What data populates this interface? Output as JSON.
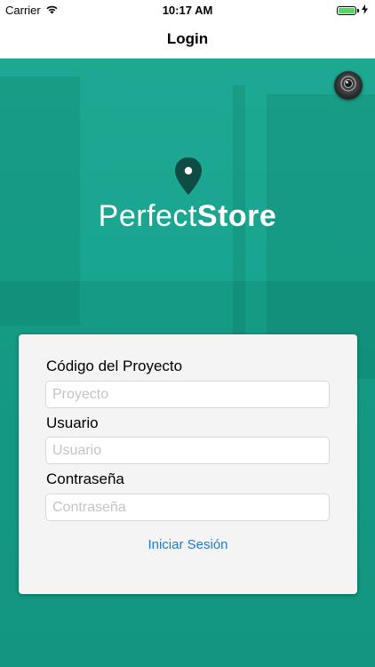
{
  "status_bar": {
    "carrier": "Carrier",
    "time": "10:17 AM",
    "battery_level": 1.0,
    "battery_color": "#4cd964"
  },
  "nav": {
    "title": "Login"
  },
  "hero": {
    "background_color": "#18a58f",
    "settings_icon": "lens-icon"
  },
  "logo": {
    "icon": "location-pin-icon",
    "text_light": "Perfect",
    "text_bold": "Store"
  },
  "form": {
    "project": {
      "label": "Código del Proyecto",
      "placeholder": "Proyecto",
      "value": ""
    },
    "user": {
      "label": "Usuario",
      "placeholder": "Usuario",
      "value": ""
    },
    "password": {
      "label": "Contraseña",
      "placeholder": "Contraseña",
      "value": ""
    },
    "submit_label": "Iniciar Sesión",
    "link_color": "#1f7ad6"
  }
}
